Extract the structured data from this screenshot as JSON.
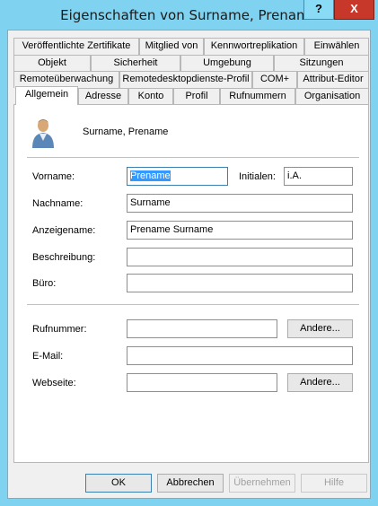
{
  "window": {
    "title": "Eigenschaften von Surname, Prename",
    "help_label": "?",
    "close_label": "X"
  },
  "tabs": {
    "row1": [
      "Veröffentlichte Zertifikate",
      "Mitglied von",
      "Kennwortreplikation",
      "Einwählen"
    ],
    "row2": [
      "Objekt",
      "Sicherheit",
      "Umgebung",
      "Sitzungen"
    ],
    "row3": [
      "Remoteüberwachung",
      "Remotedesktopdienste-Profil",
      "COM+",
      "Attribut-Editor"
    ],
    "row4": [
      "Allgemein",
      "Adresse",
      "Konto",
      "Profil",
      "Rufnummern",
      "Organisation"
    ],
    "active": "Allgemein"
  },
  "general": {
    "display_header": "Surname, Prename",
    "vorname_label": "Vorname:",
    "vorname_value": "Prename",
    "initialen_label": "Initialen:",
    "initialen_value": "i.A.",
    "nachname_label": "Nachname:",
    "nachname_value": "Surname",
    "anzeigename_label": "Anzeigename:",
    "anzeigename_value": "Prename Surname",
    "beschreibung_label": "Beschreibung:",
    "beschreibung_value": "",
    "buero_label": "Büro:",
    "buero_value": "",
    "rufnummer_label": "Rufnummer:",
    "rufnummer_value": "",
    "email_label": "E-Mail:",
    "email_value": "",
    "webseite_label": "Webseite:",
    "webseite_value": "",
    "andere_label": "Andere..."
  },
  "footer": {
    "ok": "OK",
    "cancel": "Abbrechen",
    "apply": "Übernehmen",
    "help": "Hilfe"
  },
  "icons": {
    "user_icon": "user-icon"
  },
  "colors": {
    "title_bar": "#7fd3f0",
    "close_button": "#c7382b",
    "selection": "#3399ff",
    "dialog_bg": "#f0f0f0"
  }
}
